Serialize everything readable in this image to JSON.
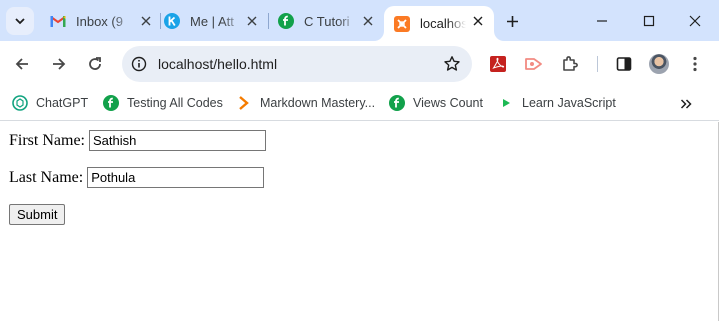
{
  "tabs": [
    {
      "title": "Inbox (9",
      "icon": "gmail-icon"
    },
    {
      "title": "Me | Att",
      "icon": "k-letter-icon"
    },
    {
      "title": "C Tutori",
      "icon": "f-leaf-icon"
    },
    {
      "title": "localhos",
      "icon": "xampp-icon",
      "active": true
    }
  ],
  "toolbar": {
    "url": "localhost/hello.html"
  },
  "bookmarks": [
    {
      "label": "ChatGPT",
      "icon": "chatgpt-icon"
    },
    {
      "label": "Testing All Codes",
      "icon": "f-leaf-icon"
    },
    {
      "label": "Markdown Mastery...",
      "icon": "chevron-icon"
    },
    {
      "label": "Views Count",
      "icon": "f-leaf-icon"
    },
    {
      "label": "Learn JavaScript",
      "icon": "play-icon"
    }
  ],
  "form": {
    "first_name_label": "First Name:",
    "first_name_value": "Sathish",
    "last_name_label": "Last Name:",
    "last_name_value": "Pothula",
    "submit_label": "Submit"
  },
  "colors": {
    "tabstrip_bg": "#d3e3fd",
    "omnibox_bg": "#e9eef6",
    "gmail_red": "#ea4335",
    "leaf_green": "#12a14b",
    "xampp_orange": "#fb7a24",
    "k_blue": "#1aa3e8"
  }
}
